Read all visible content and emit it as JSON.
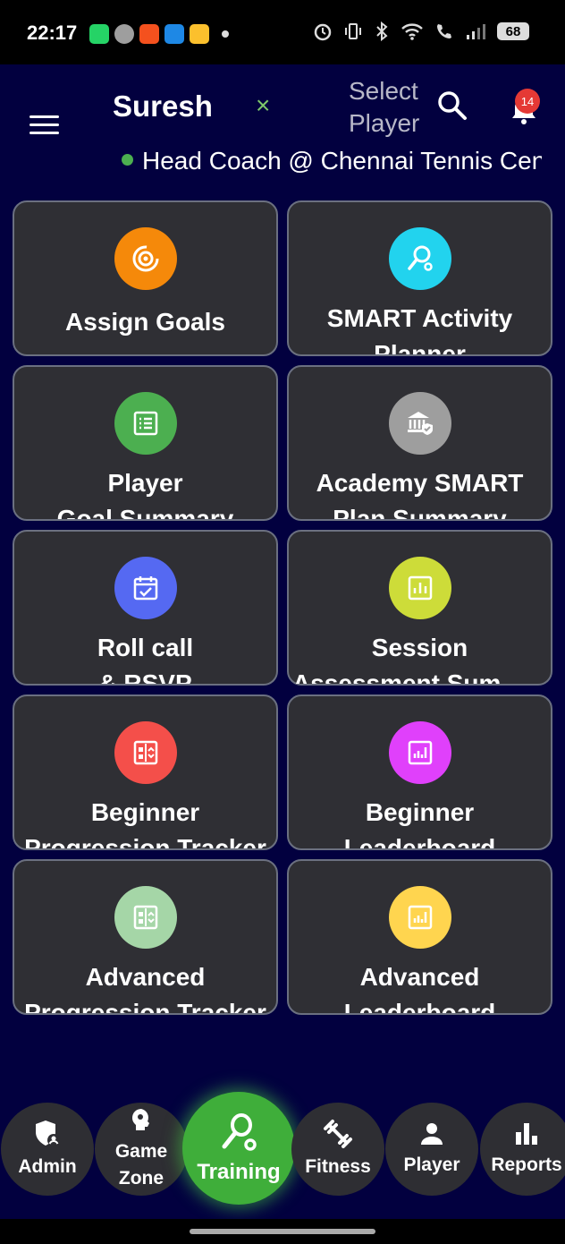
{
  "status_bar": {
    "time": "22:17",
    "battery": "68",
    "notification_icon_colors": [
      "#25d366",
      "#bdbdbd",
      "#f4511e",
      "#1e88e5",
      "#fbc02d"
    ]
  },
  "header": {
    "user_name": "Suresh",
    "close_glyph": "×",
    "select_player": "Select Player",
    "notification_count": "14",
    "role": "Head Coach @ Chennai Tennis Centre"
  },
  "tiles": [
    {
      "line1": "Assign Goals",
      "line2": "",
      "icon": "target-icon",
      "color": "#f5890a"
    },
    {
      "line1": "SMART Activity",
      "line2": "Planner",
      "icon": "racket-icon",
      "color": "#22d3ee"
    },
    {
      "line1": "Player",
      "line2": "Goal Summary",
      "icon": "list-icon",
      "color": "#4caf50"
    },
    {
      "line1": "Academy SMART",
      "line2": "Plan Summary",
      "icon": "academy-icon",
      "color": "#9e9e9e"
    },
    {
      "line1": "Roll call",
      "line2": "& RSVP",
      "icon": "calendar-check-icon",
      "color": "#5569f2"
    },
    {
      "line1": "Session",
      "line2": "Assessment Summary",
      "icon": "chart-icon",
      "color": "#cddc39"
    },
    {
      "line1": "Beginner",
      "line2": "Progression Tracker",
      "icon": "tracker-icon",
      "color": "#f44f4a"
    },
    {
      "line1": "Beginner",
      "line2": "Leaderboard",
      "icon": "leaderboard-icon",
      "color": "#e040fb"
    },
    {
      "line1": "Advanced",
      "line2": "Progression Tracker",
      "icon": "tracker-icon",
      "color": "#a5d6a7"
    },
    {
      "line1": "Advanced",
      "line2": "Leaderboard",
      "icon": "leaderboard-icon",
      "color": "#ffd54f"
    }
  ],
  "bottom_nav": [
    {
      "label": "Admin",
      "icon": "admin-shield-icon"
    },
    {
      "label": "Game Zone",
      "icon": "game-zone-icon"
    },
    {
      "label": "Training",
      "icon": "racket-icon",
      "active": true
    },
    {
      "label": "Fitness",
      "icon": "dumbbell-icon"
    },
    {
      "label": "Player",
      "icon": "person-icon"
    },
    {
      "label": "Reports",
      "icon": "bar-chart-icon"
    }
  ]
}
